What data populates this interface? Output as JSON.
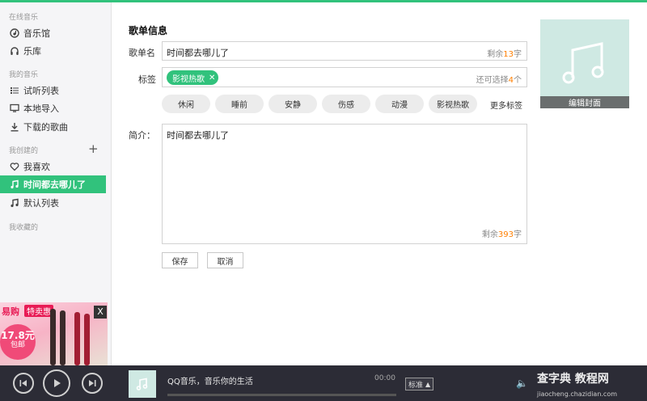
{
  "sidebar": {
    "online_title": "在线音乐",
    "online_items": [
      {
        "label": "音乐馆",
        "icon": "music-hall-icon"
      },
      {
        "label": "乐库",
        "icon": "headphones-icon"
      }
    ],
    "my_title": "我的音乐",
    "my_items": [
      {
        "label": "试听列表",
        "icon": "list-icon"
      },
      {
        "label": "本地导入",
        "icon": "monitor-icon"
      },
      {
        "label": "下载的歌曲",
        "icon": "download-icon"
      }
    ],
    "created_title": "我创建的",
    "created_items": [
      {
        "label": "我喜欢",
        "icon": "heart-icon"
      },
      {
        "label": "时间都去哪儿了",
        "icon": "music-note-icon",
        "active": true
      },
      {
        "label": "默认列表",
        "icon": "music-note-icon"
      }
    ],
    "collected_title": "我收藏的",
    "ad": {
      "brand": "易购",
      "tag": "特卖惠",
      "price": "17.8元",
      "sub": "包邮",
      "close": "X"
    }
  },
  "editor": {
    "section_title": "歌单信息",
    "name_label": "歌单名",
    "name_value": "时间都去哪儿了",
    "name_counter_prefix": "剩余",
    "name_counter_num": "13",
    "name_counter_suffix": "字",
    "tags_label": "标签",
    "selected_tag": "影视热歌",
    "tags_counter_prefix": "还可选择",
    "tags_counter_num": "4",
    "tags_counter_suffix": "个",
    "tag_options": [
      "休闲",
      "睡前",
      "安静",
      "伤感",
      "动漫",
      "影视热歌"
    ],
    "more_tags": "更多标签",
    "intro_label": "简介：",
    "intro_value": "时间都去哪儿了",
    "intro_counter_prefix": "剩余",
    "intro_counter_num": "393",
    "intro_counter_suffix": "字",
    "save_label": "保存",
    "cancel_label": "取消",
    "cover_label": "编辑封面"
  },
  "player": {
    "song_text": "QQ音乐，音乐你的生活",
    "time": "00:00",
    "quality": "标准",
    "progress": 0
  },
  "watermark": {
    "main": "查字典 教程网",
    "sub": "jiaocheng.chazidian.com"
  },
  "colors": {
    "accent": "#31c27c",
    "counter": "#ff7f00",
    "player_bg": "#2c2c36"
  }
}
